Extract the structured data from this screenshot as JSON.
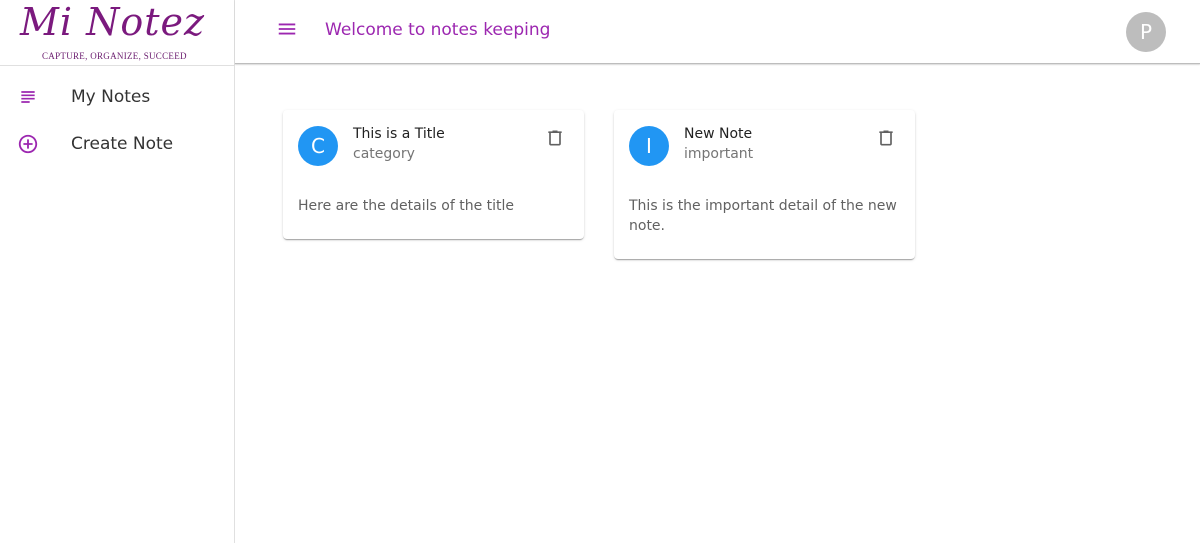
{
  "logo": {
    "name": "Mi Notez",
    "tagline": "CAPTURE, ORGANIZE, SUCCEED"
  },
  "sidebar": {
    "items": [
      {
        "label": "My Notes",
        "icon": "subject-icon"
      },
      {
        "label": "Create Note",
        "icon": "add-circle-outline-icon"
      }
    ]
  },
  "header": {
    "title": "Welcome to notes keeping",
    "menu_icon": "menu-icon",
    "avatar_letter": "P"
  },
  "notes": [
    {
      "avatar": "C",
      "title": "This is a Title",
      "category": "category",
      "details": "Here are the details of the title",
      "delete_icon": "delete-icon"
    },
    {
      "avatar": "I",
      "title": "New Note",
      "category": "important",
      "details": "This is the important detail of the new note.",
      "delete_icon": "delete-icon"
    }
  ],
  "colors": {
    "accent": "#9c27b0",
    "logo": "#7b1a7e",
    "note_avatar": "#2196f3",
    "user_avatar": "#bdbdbd"
  }
}
